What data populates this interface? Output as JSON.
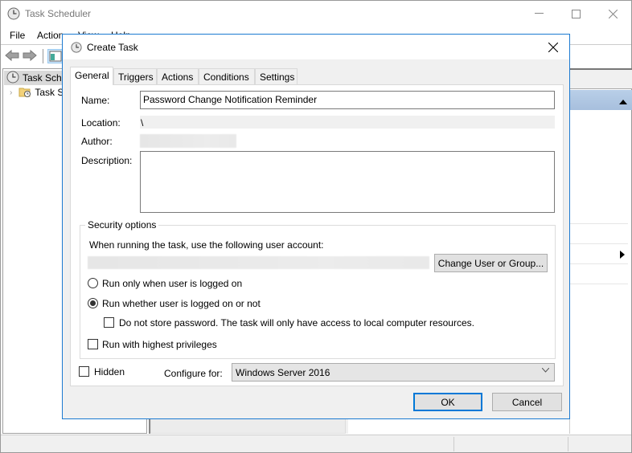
{
  "main_window": {
    "title": "Task Scheduler",
    "controls": {
      "minimize": "—",
      "maximize": "☐",
      "close": "✕"
    },
    "menu": [
      "File",
      "Action",
      "View",
      "Help"
    ],
    "tree": [
      {
        "label": "Task Scheduler (Local)",
        "icon": "clock-icon",
        "selected": true
      },
      {
        "label": "Task Scheduler Library",
        "icon": "folder-clock-icon",
        "selected": false
      }
    ]
  },
  "dialog": {
    "title": "Create Task",
    "close_label": "✕",
    "tabs": [
      {
        "label": "General",
        "active": true
      },
      {
        "label": "Triggers",
        "active": false
      },
      {
        "label": "Actions",
        "active": false
      },
      {
        "label": "Conditions",
        "active": false
      },
      {
        "label": "Settings",
        "active": false
      }
    ],
    "general": {
      "name_label": "Name:",
      "name_value": "Password Change Notification Reminder",
      "location_label": "Location:",
      "location_value": "\\",
      "author_label": "Author:",
      "author_value": "",
      "description_label": "Description:",
      "description_value": "",
      "security": {
        "title": "Security options",
        "account_prompt": "When running the task, use the following user account:",
        "account_value": "",
        "change_user_button": "Change User or Group...",
        "radio_logged_on": {
          "label": "Run only when user is logged on",
          "checked": false
        },
        "radio_whether": {
          "label": "Run whether user is logged on or not",
          "checked": true
        },
        "do_not_store": {
          "label": "Do not store password.  The task will only have access to local computer resources.",
          "checked": false
        },
        "highest_privileges": {
          "label": "Run with highest privileges",
          "checked": false
        }
      },
      "hidden": {
        "label": "Hidden",
        "checked": false
      },
      "configure_for_label": "Configure for:",
      "configure_for_value": "Windows Server 2016"
    },
    "ok_button": "OK",
    "cancel_button": "Cancel"
  }
}
